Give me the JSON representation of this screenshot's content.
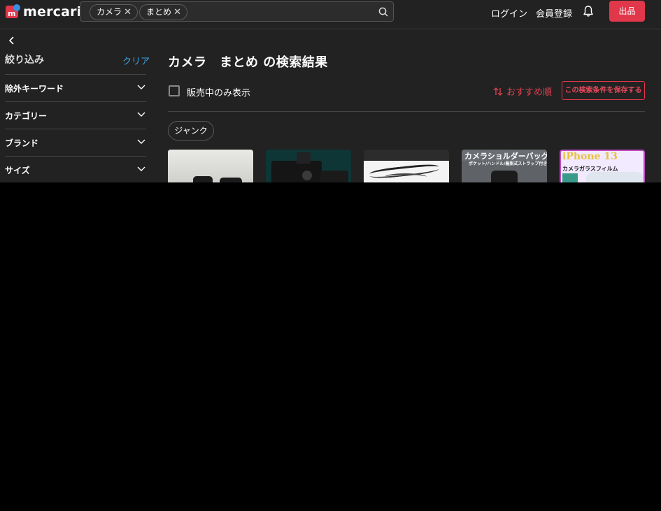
{
  "header": {
    "logo_text": "mercari",
    "search_chips": [
      {
        "label": "カメラ"
      },
      {
        "label": "まとめ"
      }
    ],
    "login_label": "ログイン",
    "signup_label": "会員登録",
    "sell_label": "出品"
  },
  "sidebar": {
    "title": "絞り込み",
    "clear_label": "クリア",
    "items": [
      {
        "label": "除外キーワード"
      },
      {
        "label": "カテゴリー"
      },
      {
        "label": "ブランド"
      },
      {
        "label": "サイズ"
      }
    ]
  },
  "main": {
    "title": "カメラ　まとめ の検索結果",
    "on_sale_label": "販売中のみ表示",
    "sort_label": "おすすめ順",
    "save_search_label": "この検索条件を保存する",
    "tag_label": "ジャンク",
    "thumbnails": [
      {
        "text": ""
      },
      {
        "text": ""
      },
      {
        "text": ""
      },
      {
        "text": "カメラショルダーバッグ",
        "subtext": "ポケット/ハンドル/着脱式ストラップ付き"
      },
      {
        "text": "iPhone 13",
        "subtext": "カメラガラスフィルム"
      }
    ]
  },
  "colors": {
    "brand_red": "#e0374a",
    "link_blue": "#3ca5e8",
    "background": "#222222"
  }
}
